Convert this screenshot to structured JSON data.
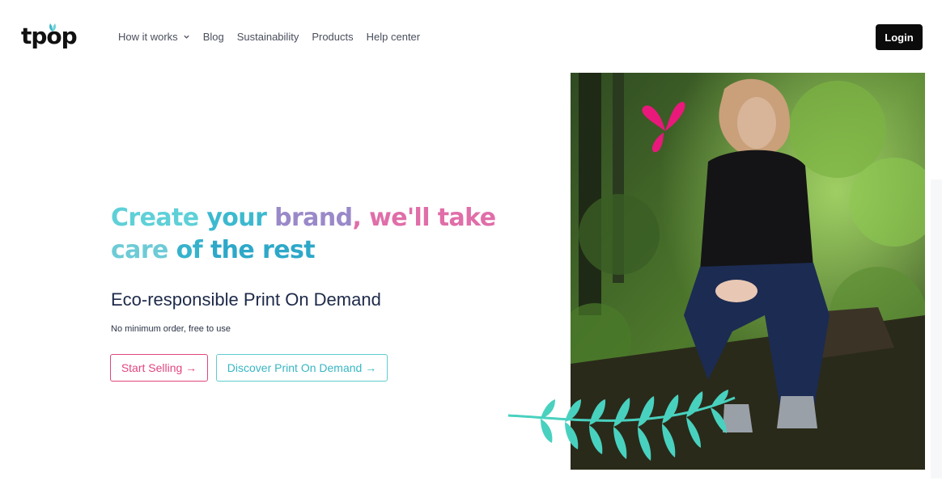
{
  "brand": {
    "logo_text": "tpop"
  },
  "nav": {
    "items": [
      {
        "label": "How it works",
        "has_dropdown": true
      },
      {
        "label": "Blog"
      },
      {
        "label": "Sustainability"
      },
      {
        "label": "Products"
      },
      {
        "label": "Help center"
      }
    ]
  },
  "header": {
    "login_label": "Login"
  },
  "hero": {
    "title_parts": [
      "Create ",
      "your ",
      "brand",
      ", we'll take",
      "care ",
      "of ",
      "the rest"
    ],
    "subtitle": "Eco-responsible Print On Demand",
    "note": "No minimum order, free to use",
    "primary_button": "Start Selling →",
    "secondary_button": "Discover Print On Demand →"
  },
  "colors": {
    "accent_pink": "#e2457f",
    "accent_teal": "#5fcdd0",
    "login_bg": "#0b0b0b"
  },
  "icons": {
    "nav_dropdown": "chevron-down-icon",
    "logo_leaf": "leaf-icon",
    "decor_butterfly": "butterfly-icon",
    "decor_fern": "fern-leaf-icon"
  }
}
